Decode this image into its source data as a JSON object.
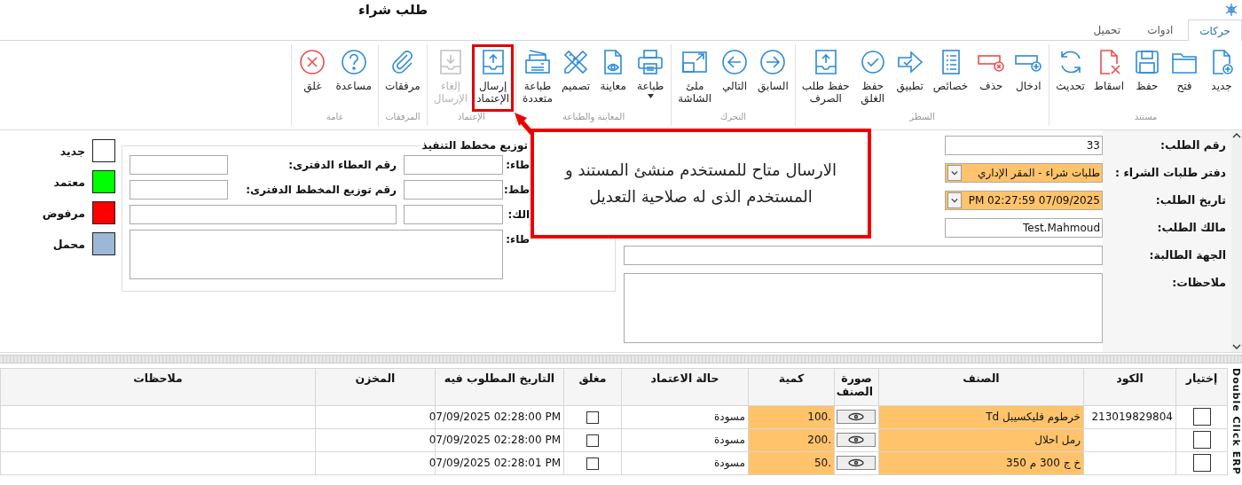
{
  "window": {
    "title": "طلب شراء"
  },
  "tabs": [
    {
      "label": "حركات",
      "selected": true
    },
    {
      "label": "ادوات",
      "selected": false
    },
    {
      "label": "تحميل",
      "selected": false
    }
  ],
  "ribbon": {
    "groups": [
      {
        "label": "مستند",
        "buttons": [
          {
            "label": "جديد",
            "disabled": false,
            "menu": false,
            "highlighted": false
          },
          {
            "label": "فتح",
            "disabled": false,
            "menu": false,
            "highlighted": false
          },
          {
            "label": "حفظ",
            "disabled": false,
            "menu": false,
            "highlighted": false
          },
          {
            "label": "اسقاط",
            "disabled": false,
            "menu": false,
            "highlighted": false
          },
          {
            "label": "تحديث",
            "disabled": false,
            "menu": false,
            "highlighted": false
          }
        ]
      },
      {
        "label": "السطر",
        "buttons": [
          {
            "label": "ادخال",
            "disabled": false,
            "menu": false,
            "highlighted": false
          },
          {
            "label": "حذف",
            "disabled": false,
            "menu": false,
            "highlighted": false
          },
          {
            "label": "خصائص",
            "disabled": false,
            "menu": false,
            "highlighted": false
          },
          {
            "label": "تطبيق",
            "disabled": false,
            "menu": false,
            "highlighted": false
          },
          {
            "label": "حفظ\nالغلق",
            "disabled": false,
            "menu": false,
            "highlighted": false
          },
          {
            "label": "حفظ طلب\nالصرف",
            "disabled": false,
            "menu": false,
            "highlighted": false
          }
        ]
      },
      {
        "label": "التحرك",
        "buttons": [
          {
            "label": "السابق",
            "disabled": false,
            "menu": false,
            "highlighted": false
          },
          {
            "label": "التالي",
            "disabled": false,
            "menu": false,
            "highlighted": false
          },
          {
            "label": "ملئ\nالشاشة",
            "disabled": false,
            "menu": false,
            "highlighted": false
          }
        ]
      },
      {
        "label": "المعاينة والطباعة",
        "buttons": [
          {
            "label": "طباعة",
            "disabled": false,
            "menu": true,
            "highlighted": false
          },
          {
            "label": "معاينة",
            "disabled": false,
            "menu": false,
            "highlighted": false
          },
          {
            "label": "تصميم",
            "disabled": false,
            "menu": false,
            "highlighted": false
          },
          {
            "label": "طباعة\nمتعددة",
            "disabled": false,
            "menu": false,
            "highlighted": false
          }
        ]
      },
      {
        "label": "الإعتماد",
        "buttons": [
          {
            "label": "إرسال\nالإعتماد",
            "disabled": false,
            "menu": false,
            "highlighted": true
          },
          {
            "label": "إلغاء\nالإرسال",
            "disabled": true,
            "menu": false,
            "highlighted": false
          }
        ]
      },
      {
        "label": "المرفقات",
        "buttons": [
          {
            "label": "مرفقات",
            "disabled": false,
            "menu": false,
            "highlighted": false
          }
        ]
      },
      {
        "label": "عامة",
        "buttons": [
          {
            "label": "مساعدة",
            "disabled": false,
            "menu": false,
            "highlighted": false
          },
          {
            "label": "غلق",
            "disabled": false,
            "menu": false,
            "highlighted": false
          }
        ]
      }
    ]
  },
  "request": {
    "fields": [
      {
        "label": "رقم الطلب:",
        "kind": "text",
        "value": "33",
        "required": false
      },
      {
        "label": "دفتر طلبات الشراء :",
        "kind": "combo",
        "value": "طلبات شراء - المقر الإداري",
        "required": true
      },
      {
        "label": "تاريخ الطلب:",
        "kind": "date",
        "value": "07/09/2025 02:27:59 PM",
        "required": true
      },
      {
        "label": "مالك الطلب:",
        "kind": "text",
        "value": "Test.Mahmoud",
        "required": false
      },
      {
        "label": "الجهة الطالبة:",
        "kind": "wide",
        "required": false
      },
      {
        "label": "ملاحظات:",
        "kind": "memo",
        "required": false
      }
    ]
  },
  "execution_group": {
    "title": "توزيع مخطط التنفيذ",
    "rows": [
      {
        "kind": "two",
        "label": "طاء:",
        "label_2": "رقم العطاء الدفترى:"
      },
      {
        "kind": "two",
        "label": "طط:",
        "label_2": "رقم توزيع المخطط الدفترى:"
      },
      {
        "kind": "pair",
        "label": "الك:"
      },
      {
        "kind": "memo",
        "label": "طاء:"
      }
    ]
  },
  "status_legend": [
    {
      "label": "جديد",
      "color": "#ffffff"
    },
    {
      "label": "معتمد",
      "color": "#00ff00"
    },
    {
      "label": "مرفوض",
      "color": "#ff0000"
    },
    {
      "label": "محمل",
      "color": "#9cb8d6"
    }
  ],
  "callout": {
    "text": "الارسال متاح للمستخدم منشئ المستند و\nالمستخدم الذى له صلاحية التعديل"
  },
  "lines": {
    "columns": [
      "إختيار",
      "الكود",
      "الصنف",
      "صورة الصنف",
      "كمية",
      "حالة الاعتماد",
      "مغلق",
      "التاريخ المطلوب فيه",
      "المخزن",
      "ملاحظات"
    ],
    "rows": [
      {
        "checked": false,
        "code": "213019829804",
        "item": "خرطوم فليكسيبل Td",
        "quantity": "100.",
        "status": "مسودة",
        "closed": false,
        "required_date": "07/09/2025 02:28:00 PM"
      },
      {
        "checked": false,
        "item": "رمل احلال",
        "quantity": "200.",
        "status": "مسودة",
        "closed": false,
        "required_date": "07/09/2025 02:28:00 PM"
      },
      {
        "checked": false,
        "item": "خ ج 300 م 350",
        "quantity": "50.",
        "status": "مسودة",
        "closed": false,
        "required_date": "07/09/2025 02:28:01 PM"
      }
    ]
  },
  "side_label": "Double Click ERP"
}
